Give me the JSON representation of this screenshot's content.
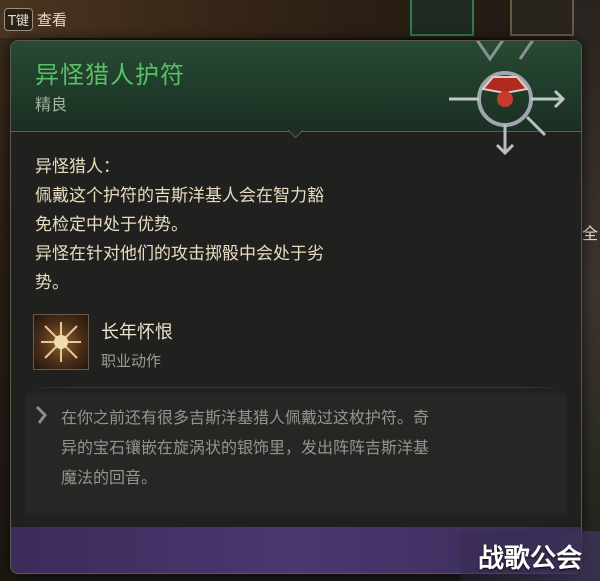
{
  "hint": {
    "key": "T键",
    "label": "查看"
  },
  "side_char": "全",
  "tooltip": {
    "title": "异怪猎人护符",
    "rarity": "精良",
    "effect_lines": [
      "异怪猎人：",
      "佩戴这个护符的吉斯洋基人会在智力豁",
      "免检定中处于优势。",
      "异怪在针对他们的攻击掷骰中会处于劣",
      "势。"
    ],
    "skill": {
      "name": "长年怀恨",
      "type": "职业动作",
      "icon": "sword-burst-icon"
    },
    "lore_lines": [
      "在你之前还有很多吉斯洋基猎人佩戴过这枚护符。奇",
      "异的宝石镶嵌在旋涡状的银饰里，发出阵阵吉斯洋基",
      "魔法的回音。"
    ]
  },
  "watermark": "战歌公会",
  "colors": {
    "title": "#58c067",
    "header": "#284a34",
    "footer": "#4a3870"
  }
}
